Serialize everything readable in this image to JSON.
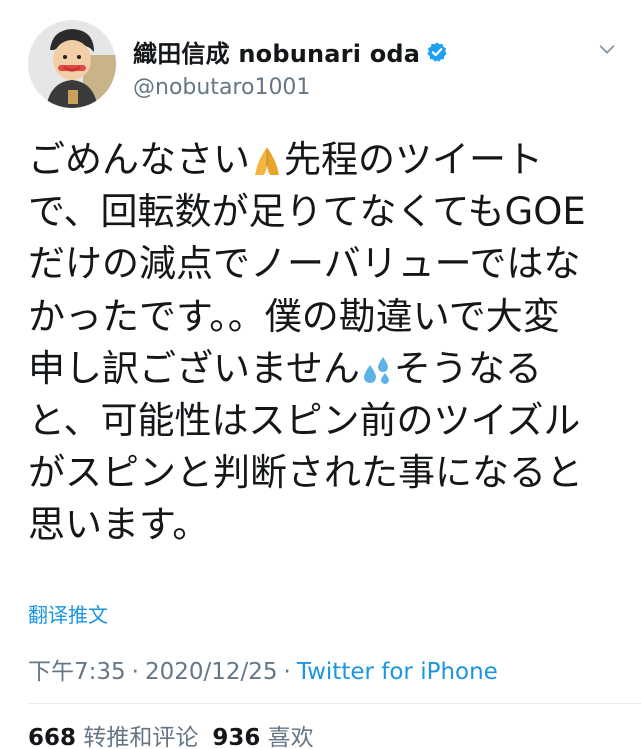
{
  "tweet": {
    "author": {
      "display_name": "織田信成 nobunari oda",
      "handle": "@nobutaro1001",
      "verified": true,
      "avatar_icon": "avatar-photo"
    },
    "menu_icon": "chevron-down-icon",
    "text_lines": [
      "ごめんなさい",
      "先程のツイート",
      "で、回転数が足りてなくてもGOE",
      "だけの減点でノーバリューではな",
      "かったです。。僕の勘違いで大変",
      "申し訳ございません",
      "そうなる",
      "と、可能性はスピン前のツイズル",
      "がスピンと判断された事になると",
      "思います。"
    ],
    "emojis": [
      "folded-hands-icon",
      "sweat-droplets-icon"
    ],
    "translate_label": "翻译推文",
    "time": "下午7:35",
    "date": "2020/12/25",
    "separator": "·",
    "source": "Twitter for iPhone",
    "retweets_count": "668",
    "retweets_label": "转推和评论",
    "likes_count": "936",
    "likes_label": "喜欢"
  },
  "colors": {
    "text": "#14171a",
    "secondary": "#657786",
    "link": "#1b95e0",
    "divider": "#e6ecf0",
    "verified": "#1da1f2",
    "folded_hands": "#f5b63f",
    "droplets": "#5db3e6"
  }
}
